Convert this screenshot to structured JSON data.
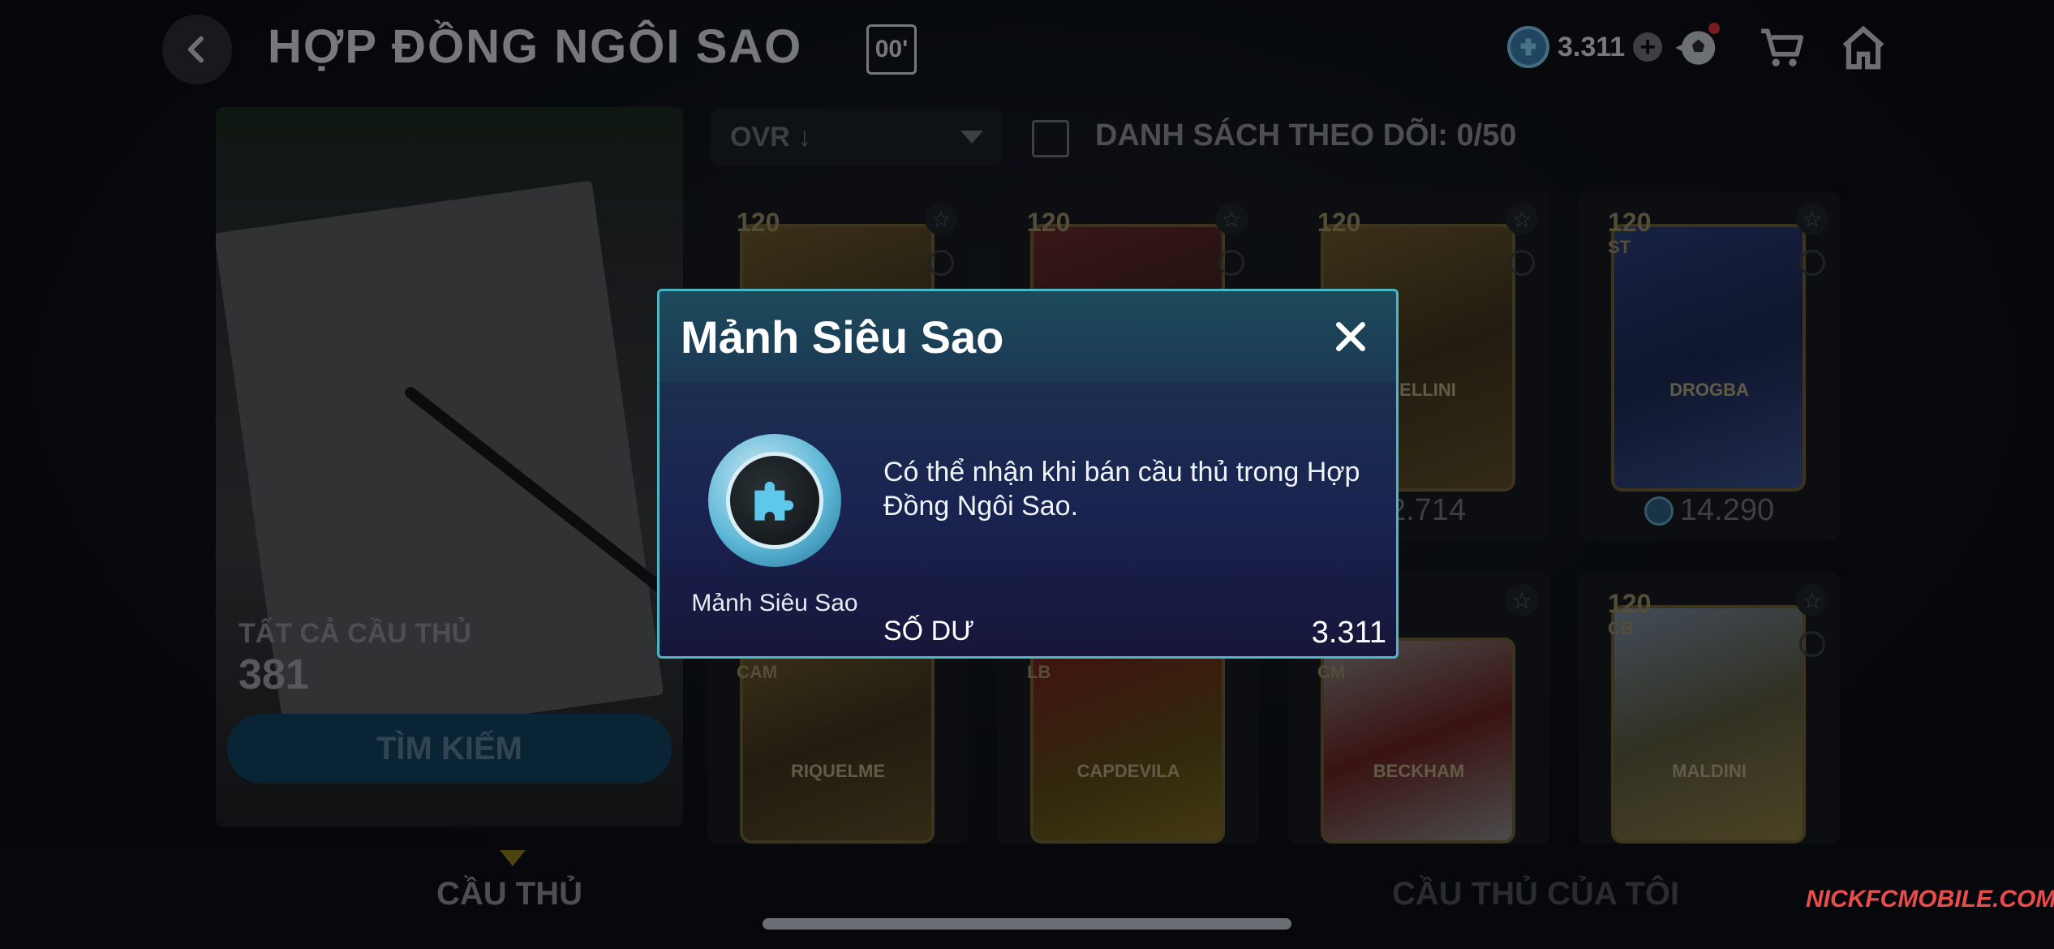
{
  "header": {
    "title": "HỢP ĐỒNG NGÔI SAO",
    "badge": "00'",
    "currency_value": "3.311",
    "icons": [
      "back-icon",
      "coin-icon",
      "plus-icon",
      "ball-icon",
      "cart-icon",
      "home-icon"
    ]
  },
  "left_panel": {
    "all_label": "TẤT CẢ CẦU THỦ",
    "all_count": "381",
    "search_button": "TÌM KIẾM"
  },
  "toolbar": {
    "sort_value": "OVR ↓",
    "watchlist_label": "DANH SÁCH THEO DÕI: 0/50"
  },
  "cards": [
    {
      "ovr": "120",
      "pos": "",
      "name": "",
      "price": ""
    },
    {
      "ovr": "120",
      "pos": "",
      "name": "",
      "price": ""
    },
    {
      "ovr": "120",
      "pos": "",
      "name": "HIELLINI",
      "price": "12.714"
    },
    {
      "ovr": "120",
      "pos": "ST",
      "name": "DROGBA",
      "price": "14.290"
    },
    {
      "ovr": "",
      "pos": "CAM",
      "name": "RIQUELME",
      "price": ""
    },
    {
      "ovr": "",
      "pos": "LB",
      "name": "CAPDEVILA",
      "price": ""
    },
    {
      "ovr": "",
      "pos": "CM",
      "name": "BECKHAM",
      "price": ""
    },
    {
      "ovr": "120",
      "pos": "CB",
      "name": "MALDINI",
      "price": ""
    }
  ],
  "tabs": {
    "players": "CẦU THỦ",
    "my_players": "CẦU THỦ CỦA TÔI"
  },
  "watermark": "NICKFCMOBILE.COM",
  "modal": {
    "title": "Mảnh Siêu Sao",
    "item_label": "Mảnh Siêu Sao",
    "description": "Có thể nhận khi bán cầu thủ trong Hợp Đồng Ngôi Sao.",
    "balance_label": "SỐ DƯ",
    "balance_value": "3.311",
    "icon": "puzzle-piece-icon"
  },
  "colors": {
    "modal_border": "#4bb7c5",
    "accent_blue": "#3b7fb0",
    "card_gold": "#6e5f35"
  }
}
